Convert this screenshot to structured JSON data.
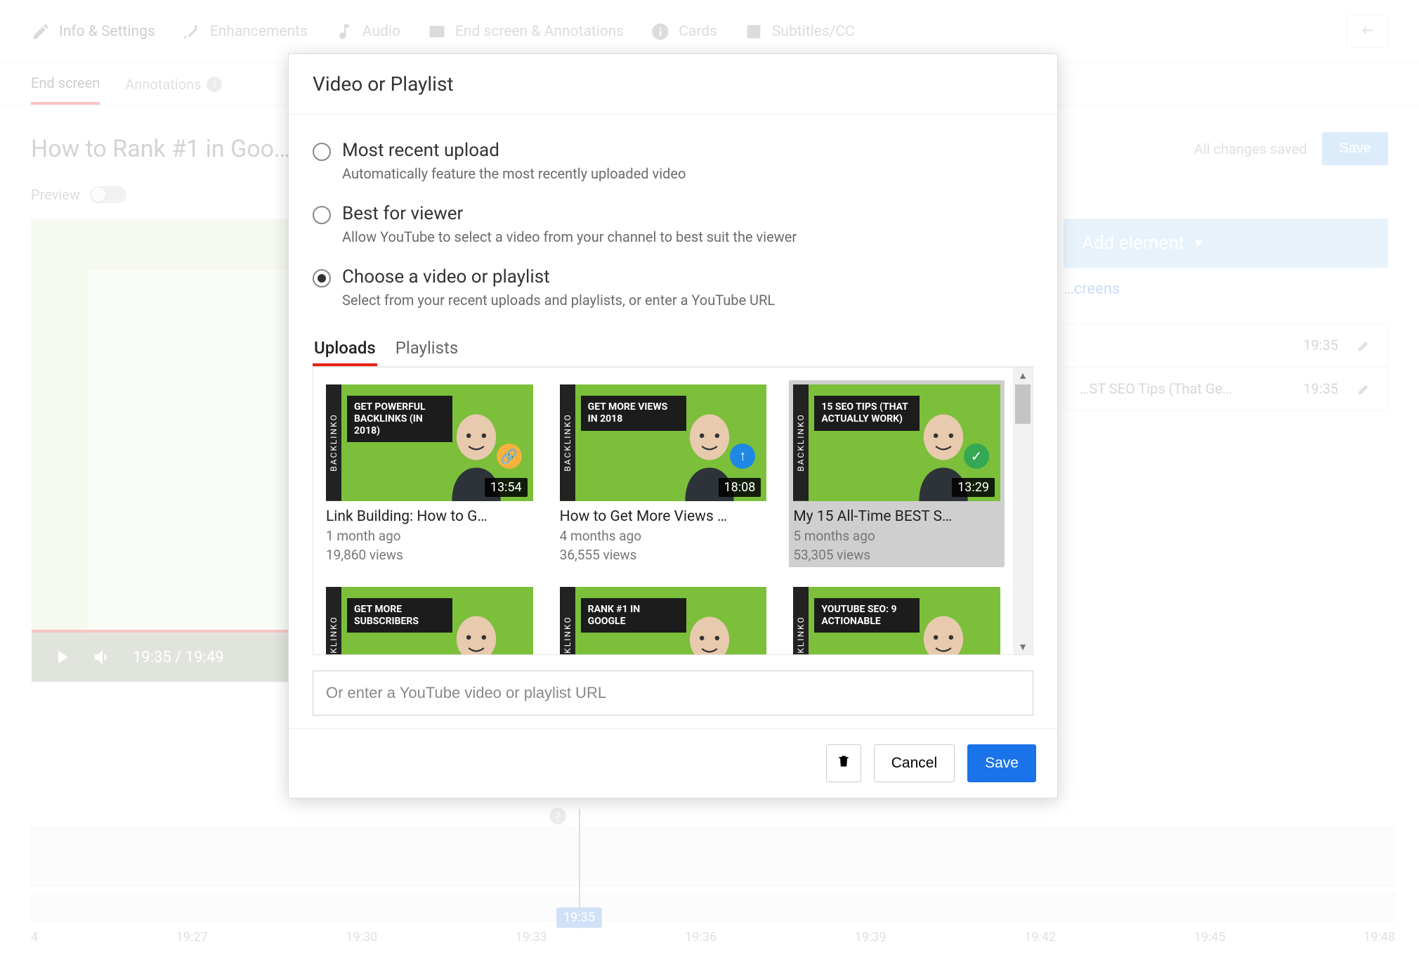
{
  "topnav": {
    "info": "Info & Settings",
    "enhancements": "Enhancements",
    "audio": "Audio",
    "endscreen": "End screen & Annotations",
    "cards": "Cards",
    "subtitles": "Subtitles/CC"
  },
  "subtabs": {
    "endscreen": "End screen",
    "annotations": "Annotations",
    "annotation_badge": "!"
  },
  "title": "How to Rank #1 in Goo…",
  "preview_label": "Preview",
  "status": "All changes saved",
  "save_top": "Save",
  "player": {
    "current": "19:35",
    "total": "19:49"
  },
  "right": {
    "add_element": "Add element",
    "import": "…creens",
    "rows": [
      {
        "title": "",
        "time": "19:35"
      },
      {
        "title": "…ST SEO Tips (That Ge…",
        "time": "19:35"
      }
    ]
  },
  "timeline": {
    "playhead": "19:35",
    "ticks": [
      "4",
      "19:27",
      "19:30",
      "19:33",
      "19:36",
      "19:39",
      "19:42",
      "19:45",
      "19:48"
    ]
  },
  "modal": {
    "title": "Video or Playlist",
    "options": [
      {
        "title": "Most recent upload",
        "sub": "Automatically feature the most recently uploaded video",
        "selected": false
      },
      {
        "title": "Best for viewer",
        "sub": "Allow YouTube to select a video from your channel to best suit the viewer",
        "selected": false
      },
      {
        "title": "Choose a video or playlist",
        "sub": "Select from your recent uploads and playlists, or enter a YouTube URL",
        "selected": true
      }
    ],
    "tabs": {
      "uploads": "Uploads",
      "playlists": "Playlists",
      "active": "uploads"
    },
    "videos": [
      {
        "title": "Link Building: How to G…",
        "age": "1 month ago",
        "views": "19,860 views",
        "duration": "13:54",
        "plaque": "GET POWERFUL BACKLINKS (IN 2018)",
        "badge_color": "#f6b23c",
        "badge_glyph": "🔗",
        "selected": false
      },
      {
        "title": "How to Get More Views …",
        "age": "4 months ago",
        "views": "36,555 views",
        "duration": "18:08",
        "plaque": "GET MORE VIEWS IN 2018",
        "badge_color": "#1e88e5",
        "badge_glyph": "↑",
        "selected": false
      },
      {
        "title": "My 15 All-Time BEST S…",
        "age": "5 months ago",
        "views": "53,305 views",
        "duration": "13:29",
        "plaque": "15 SEO TIPS (THAT ACTUALLY WORK)",
        "badge_color": "#34a853",
        "badge_glyph": "✓",
        "selected": true
      },
      {
        "title": "",
        "age": "",
        "views": "",
        "duration": "",
        "plaque": "GET MORE SUBSCRIBERS",
        "badge_color": "#000",
        "badge_glyph": "",
        "selected": false
      },
      {
        "title": "",
        "age": "",
        "views": "",
        "duration": "",
        "plaque": "RANK #1 IN GOOGLE",
        "badge_color": "#000",
        "badge_glyph": "",
        "selected": false
      },
      {
        "title": "",
        "age": "",
        "views": "",
        "duration": "",
        "plaque": "YOUTUBE SEO: 9 ACTIONABLE",
        "badge_color": "#000",
        "badge_glyph": "",
        "selected": false
      }
    ],
    "url_placeholder": "Or enter a YouTube video or playlist URL",
    "cancel": "Cancel",
    "save": "Save"
  }
}
